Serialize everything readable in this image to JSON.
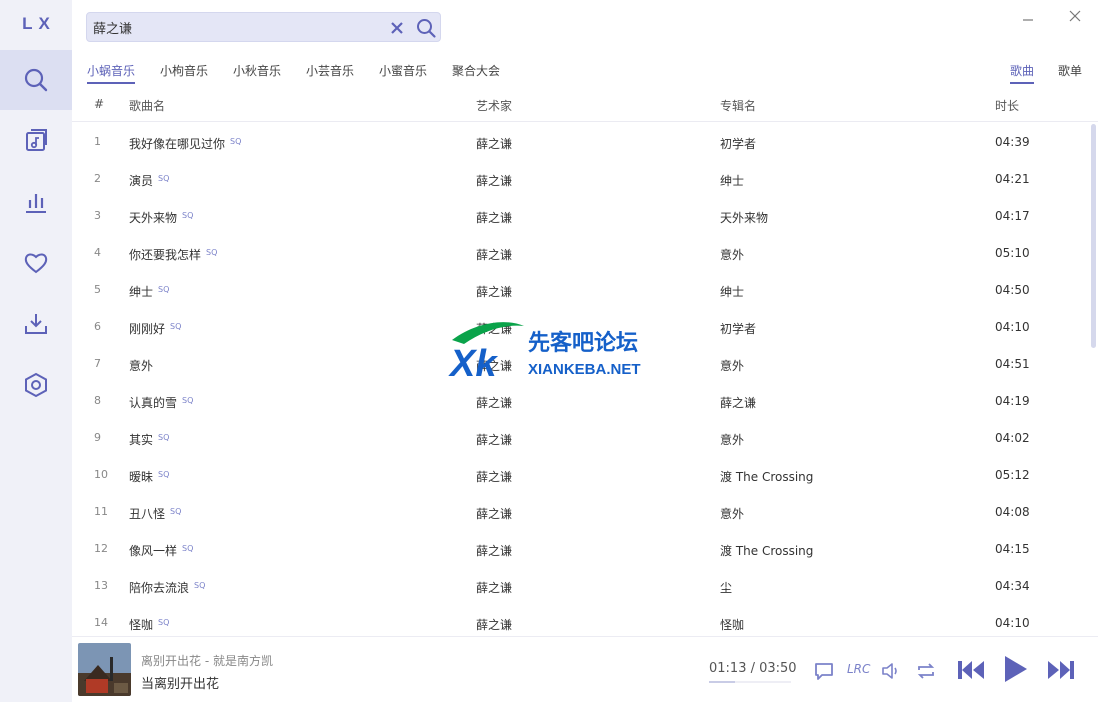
{
  "app": {
    "logo": "LX"
  },
  "search": {
    "value": "薛之谦",
    "placeholder": ""
  },
  "sidebar": {
    "items": [
      {
        "name": "search",
        "active": true
      },
      {
        "name": "song-list"
      },
      {
        "name": "leaderboard"
      },
      {
        "name": "favorites"
      },
      {
        "name": "download"
      },
      {
        "name": "settings"
      }
    ]
  },
  "source_tabs": [
    "小蜗音乐",
    "小枸音乐",
    "小秋音乐",
    "小芸音乐",
    "小蜜音乐",
    "聚合大会"
  ],
  "type_tabs": [
    "歌曲",
    "歌单"
  ],
  "table": {
    "headers": {
      "num": "#",
      "name": "歌曲名",
      "artist": "艺术家",
      "album": "专辑名",
      "duration": "时长"
    },
    "rows": [
      {
        "num": "1",
        "name": "我好像在哪见过你",
        "sq": "SQ",
        "artist": "薛之谦",
        "album": "初学者",
        "duration": "04:39"
      },
      {
        "num": "2",
        "name": "演员",
        "sq": "SQ",
        "artist": "薛之谦",
        "album": "绅士",
        "duration": "04:21"
      },
      {
        "num": "3",
        "name": "天外来物",
        "sq": "SQ",
        "artist": "薛之谦",
        "album": "天外来物",
        "duration": "04:17"
      },
      {
        "num": "4",
        "name": "你还要我怎样",
        "sq": "SQ",
        "artist": "薛之谦",
        "album": "意外",
        "duration": "05:10"
      },
      {
        "num": "5",
        "name": "绅士",
        "sq": "SQ",
        "artist": "薛之谦",
        "album": "绅士",
        "duration": "04:50"
      },
      {
        "num": "6",
        "name": "刚刚好",
        "sq": "SQ",
        "artist": "薛之谦",
        "album": "初学者",
        "duration": "04:10"
      },
      {
        "num": "7",
        "name": "意外",
        "sq": "",
        "artist": "薛之谦",
        "album": "意外",
        "duration": "04:51"
      },
      {
        "num": "8",
        "name": "认真的雪",
        "sq": "SQ",
        "artist": "薛之谦",
        "album": "薛之谦",
        "duration": "04:19"
      },
      {
        "num": "9",
        "name": "其实",
        "sq": "SQ",
        "artist": "薛之谦",
        "album": "意外",
        "duration": "04:02"
      },
      {
        "num": "10",
        "name": "暧昧",
        "sq": "SQ",
        "artist": "薛之谦",
        "album": "渡 The Crossing",
        "duration": "05:12"
      },
      {
        "num": "11",
        "name": "丑八怪",
        "sq": "SQ",
        "artist": "薛之谦",
        "album": "意外",
        "duration": "04:08"
      },
      {
        "num": "12",
        "name": "像风一样",
        "sq": "SQ",
        "artist": "薛之谦",
        "album": "渡 The Crossing",
        "duration": "04:15"
      },
      {
        "num": "13",
        "name": "陪你去流浪",
        "sq": "SQ",
        "artist": "薛之谦",
        "album": "尘",
        "duration": "04:34"
      },
      {
        "num": "14",
        "name": "怪咖",
        "sq": "SQ",
        "artist": "薛之谦",
        "album": "怪咖",
        "duration": "04:10"
      }
    ]
  },
  "watermark": {
    "title": "先客吧论坛",
    "url": "XIANKEBA.NET"
  },
  "player": {
    "subtitle": "离别开出花 - 就是南方凯",
    "title": "当离别开出花",
    "time": "01:13 / 03:50",
    "progress_fraction": 0.32,
    "lyric_button": "LRC"
  },
  "colors": {
    "accent": "#5d62b8",
    "sidebar_bg": "#f0f1f8",
    "search_bg": "#e4e6f6"
  }
}
